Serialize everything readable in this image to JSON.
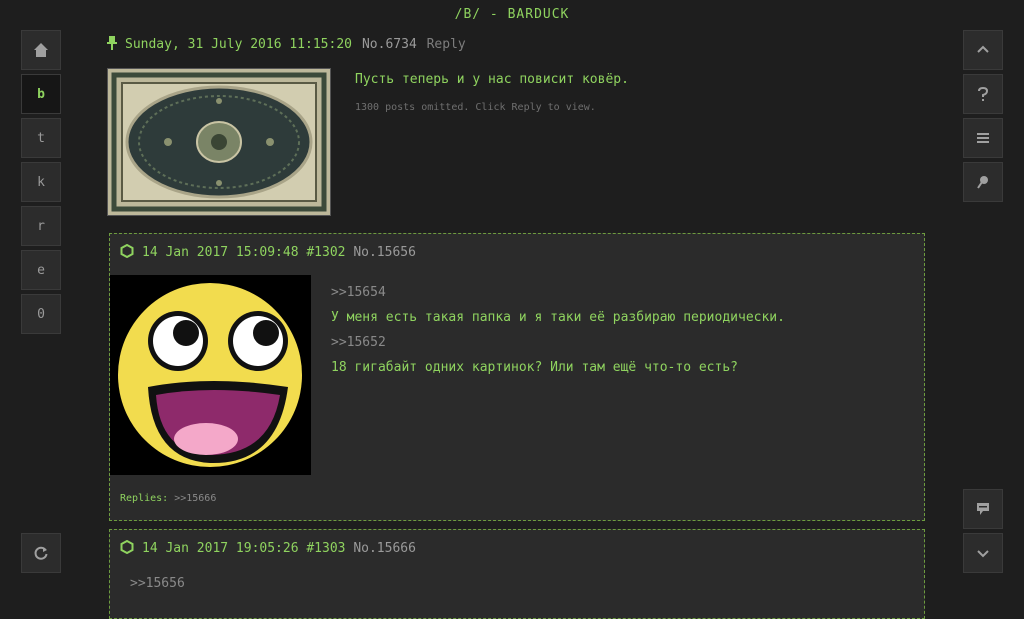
{
  "board_title": "/B/ - BARDUCK",
  "left_nav": {
    "home_icon": "home-icon",
    "boards": [
      "b",
      "t",
      "k",
      "r",
      "e",
      "0"
    ],
    "active_board": "b",
    "refresh_icon": "refresh-icon"
  },
  "right_nav": {
    "icons": [
      "chevron-up-icon",
      "question-icon",
      "menu-icon",
      "pin-icon",
      "comment-icon",
      "chevron-down-icon"
    ]
  },
  "op": {
    "date": "Sunday, 31 July 2016 11:15:20",
    "number": "No.6734",
    "reply_label": "Reply",
    "text": "Пусть теперь и у нас повисит ковёр.",
    "omitted": "1300 posts omitted. Click Reply to view."
  },
  "posts": [
    {
      "header": "14 Jan 2017 15:09:48 #1302",
      "number": "No.15656",
      "quote1": ">>15654",
      "line1": "У меня есть такая папка и я таки её разбираю периодически.",
      "quote2": ">>15652",
      "line2": "18 гигабайт одних картинок? Или там ещё что-то есть?",
      "replies_label": "Replies:",
      "replies_link": ">>15666"
    },
    {
      "header": "14 Jan 2017 19:05:26 #1303",
      "number": "No.15666",
      "quote1": ">>15656"
    }
  ]
}
